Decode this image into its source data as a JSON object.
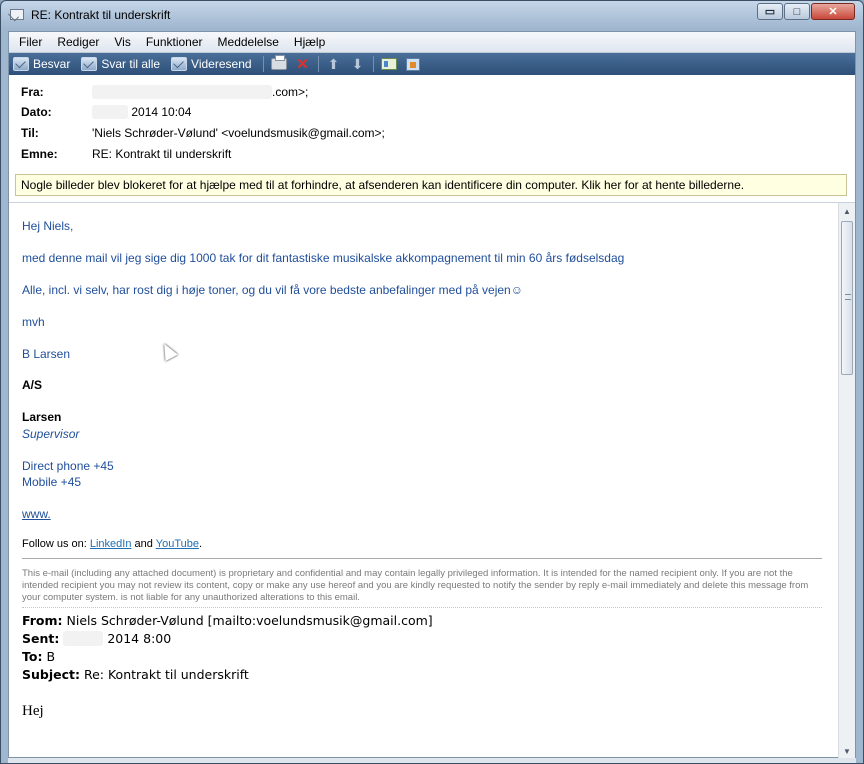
{
  "window": {
    "title": "RE: Kontrakt til underskrift",
    "buttons": {
      "minimize": "▭",
      "maximize": "□",
      "close": "✕"
    }
  },
  "menubar": [
    "Filer",
    "Rediger",
    "Vis",
    "Funktioner",
    "Meddelelse",
    "Hjælp"
  ],
  "toolbar": {
    "reply": "Besvar",
    "reply_all": "Svar til alle",
    "forward": "Videresend",
    "icons": [
      "print-icon",
      "delete-icon",
      "previous-arrow-icon",
      "next-arrow-icon",
      "contact-card-icon",
      "address-book-icon"
    ]
  },
  "headers": {
    "from_label": "Fra:",
    "from_value": ".com>;",
    "date_label": "Dato:",
    "date_value": "2014 10:04",
    "to_label": "Til:",
    "to_value": "'Niels Schrøder-Vølund' <voelundsmusik@gmail.com>;",
    "subject_label": "Emne:",
    "subject_value": "RE: Kontrakt til underskrift"
  },
  "infobar": "Nogle billeder blev blokeret for at hjælpe med til at forhindre, at afsenderen kan identificere din computer. Klik her for at hente billederne.",
  "body": {
    "greeting": "Hej Niels,",
    "line1": "med denne mail vil jeg sige dig 1000 tak for dit fantastiske musikalske akkompagnement til min 60 års fødselsdag",
    "line2": "Alle, incl. vi selv, har rost dig i høje toner, og du vil få vore bedste anbefalinger med på vejen☺",
    "closing": "mvh",
    "signer": "B       Larsen",
    "sig_company": "         A/S",
    "sig_name": "      Larsen",
    "sig_title": "Supervisor",
    "phone": "Direct phone +45",
    "mobile": "Mobile +45",
    "website": "www.",
    "follow_prefix": "Follow us on: ",
    "linkedin": "LinkedIn",
    "follow_and": " and ",
    "youtube": "YouTube",
    "follow_suffix": ".",
    "disclaimer": "This e-mail (including any attached document) is proprietary and confidential and may contain legally privileged information. It is intended for the named recipient only. If you are not the intended recipient you may not review its content, copy or make any use hereof and you are kindly requested to notify the sender by reply e-mail immediately and delete this message from your computer system.                          is not liable for any unauthorized alterations to this email."
  },
  "original": {
    "from_label": "From:",
    "from_value": "Niels Schrøder-Vølund [mailto:voelundsmusik@gmail.com]",
    "sent_label": "Sent:",
    "sent_value": "2014 8:00",
    "to_label": "To:",
    "to_value": "B",
    "subject_label": "Subject:",
    "subject_value": "Re: Kontrakt til underskrift",
    "greeting": "Hej"
  }
}
